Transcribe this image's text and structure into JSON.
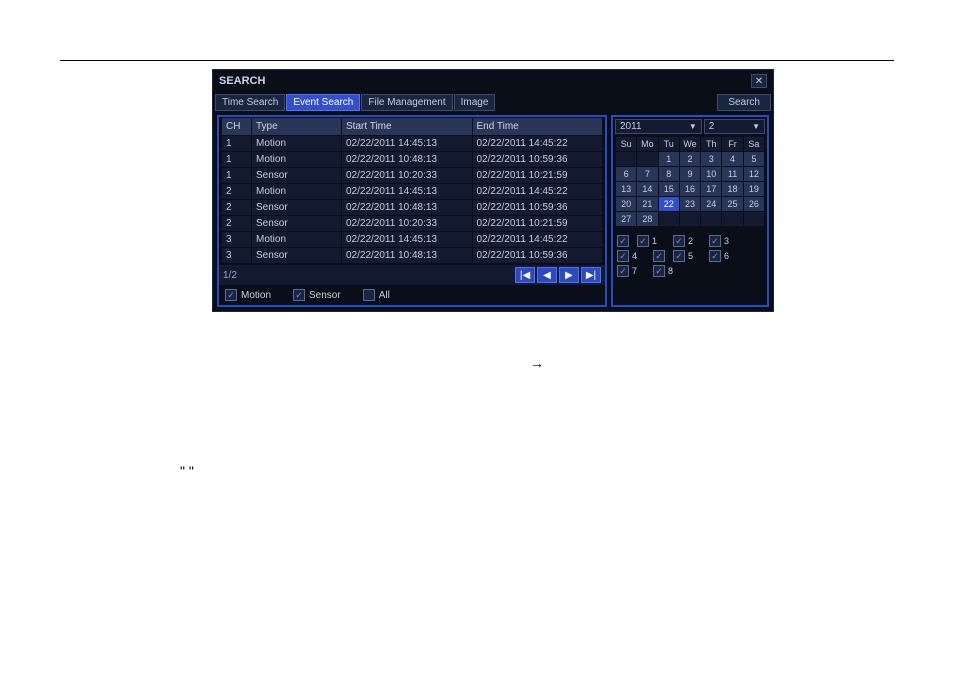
{
  "dialog": {
    "title": "SEARCH",
    "tabs": {
      "time": "Time Search",
      "event": "Event Search",
      "file": "File Management",
      "image": "Image"
    },
    "search_btn": "Search",
    "table": {
      "headers": {
        "ch": "CH",
        "type": "Type",
        "start": "Start Time",
        "end": "End Time"
      },
      "rows": [
        {
          "ch": "1",
          "type": "Motion",
          "start": "02/22/2011 14:45:13",
          "end": "02/22/2011 14:45:22"
        },
        {
          "ch": "1",
          "type": "Motion",
          "start": "02/22/2011 10:48:13",
          "end": "02/22/2011 10:59:36"
        },
        {
          "ch": "1",
          "type": "Sensor",
          "start": "02/22/2011 10:20:33",
          "end": "02/22/2011 10:21:59"
        },
        {
          "ch": "2",
          "type": "Motion",
          "start": "02/22/2011 14:45:13",
          "end": "02/22/2011 14:45:22"
        },
        {
          "ch": "2",
          "type": "Sensor",
          "start": "02/22/2011 10:48:13",
          "end": "02/22/2011 10:59:36"
        },
        {
          "ch": "2",
          "type": "Sensor",
          "start": "02/22/2011 10:20:33",
          "end": "02/22/2011 10:21:59"
        },
        {
          "ch": "3",
          "type": "Motion",
          "start": "02/22/2011 14:45:13",
          "end": "02/22/2011 14:45:22"
        },
        {
          "ch": "3",
          "type": "Sensor",
          "start": "02/22/2011 10:48:13",
          "end": "02/22/2011 10:59:36"
        }
      ]
    },
    "pager": "1/2",
    "filters": {
      "motion": "Motion",
      "sensor": "Sensor",
      "all": "All"
    }
  },
  "calendar": {
    "year": "2011",
    "month": "2",
    "days": {
      "su": "Su",
      "mo": "Mo",
      "tu": "Tu",
      "we": "We",
      "th": "Th",
      "fr": "Fr",
      "sa": "Sa"
    },
    "selected": "22"
  },
  "channels": {
    "c1": "1",
    "c2": "2",
    "c3": "3",
    "c4": "4",
    "c5": "5",
    "c6": "6",
    "c7": "7",
    "c8": "8"
  },
  "doc": {
    "arrow": "→",
    "quote": "\"  \""
  }
}
